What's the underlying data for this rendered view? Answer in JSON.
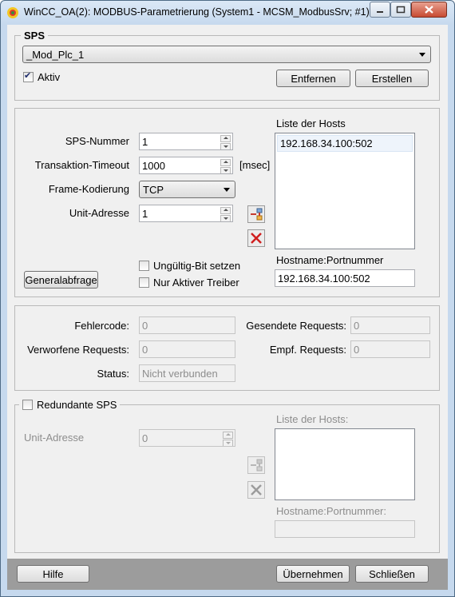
{
  "window": {
    "title": "WinCC_OA(2): MODBUS-Parametrierung (System1 - MCSM_ModbusSrv; #1)"
  },
  "sps": {
    "group_title": "SPS",
    "selected": "_Mod_Plc_1",
    "aktiv_label": "Aktiv",
    "aktiv_checked": true,
    "remove_label": "Entfernen",
    "create_label": "Erstellen"
  },
  "config": {
    "sps_nummer_label": "SPS-Nummer",
    "sps_nummer_value": "1",
    "timeout_label": "Transaktion-Timeout",
    "timeout_value": "1000",
    "timeout_unit": "[msec]",
    "frame_label": "Frame-Kodierung",
    "frame_value": "TCP",
    "unit_label": "Unit-Adresse",
    "unit_value": "1",
    "general_button": "Generalabfrage",
    "invalid_bit_label": "Ungültig-Bit setzen",
    "only_active_label": "Nur Aktiver Treiber",
    "hosts_label": "Liste der Hosts",
    "hosts": [
      "192.168.34.100:502"
    ],
    "hostname_label": "Hostname:Portnummer",
    "hostname_value": "192.168.34.100:502"
  },
  "status": {
    "fehlercode_label": "Fehlercode:",
    "fehlercode_value": "0",
    "gesendete_label": "Gesendete Requests:",
    "gesendete_value": "0",
    "verworfene_label": "Verworfene Requests:",
    "verworfene_value": "0",
    "empf_label": "Empf. Requests:",
    "empf_value": "0",
    "status_label": "Status:",
    "status_value": "Nicht verbunden"
  },
  "redundant": {
    "label": "Redundante SPS",
    "checked": false,
    "unit_label": "Unit-Adresse",
    "unit_value": "0",
    "hosts_label": "Liste der Hosts:",
    "hostname_label": "Hostname:Portnummer:",
    "hostname_value": ""
  },
  "footer": {
    "help_label": "Hilfe",
    "apply_label": "Übernehmen",
    "close_label": "Schließen"
  }
}
